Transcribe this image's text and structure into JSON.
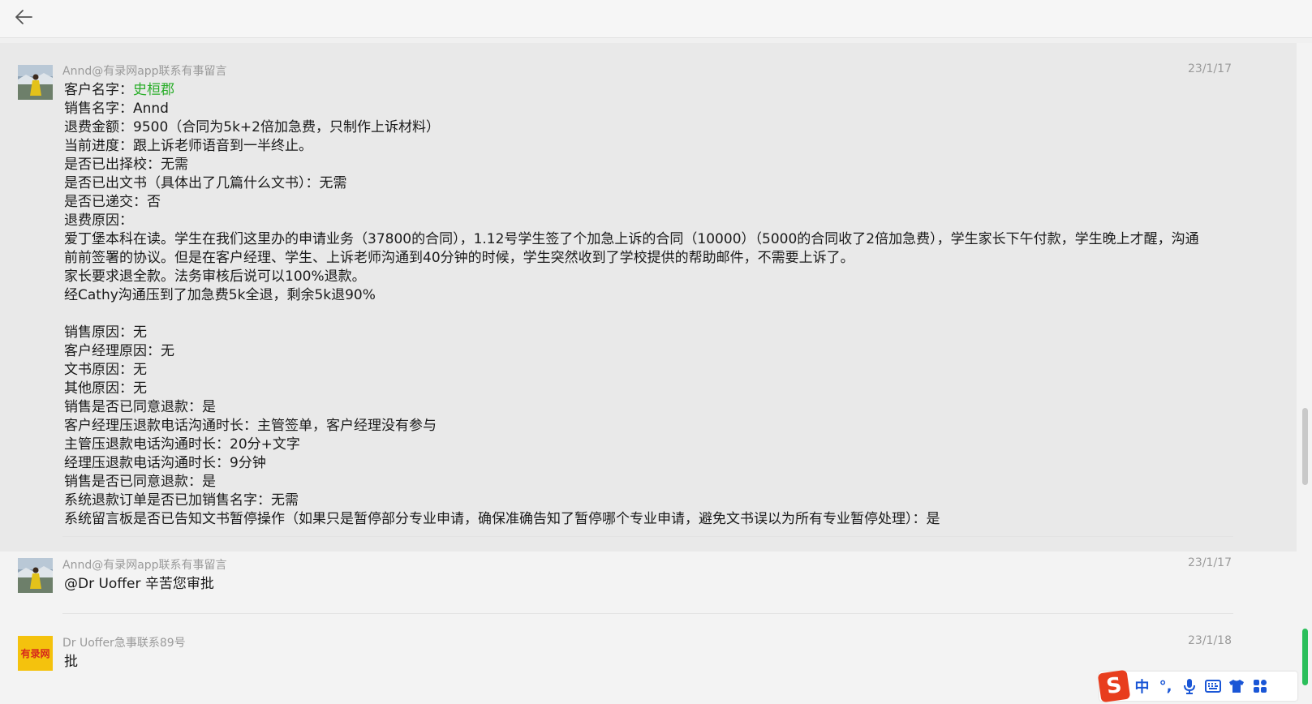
{
  "header": {
    "back_icon": "arrow-left-icon"
  },
  "messages": [
    {
      "sender": "Annd@有录网app联系有事留言",
      "timestamp": "23/1/17",
      "avatar": "user-photo-avatar",
      "lines": {
        "customer_label": "客户名字：",
        "customer_name": "史桓郡",
        "l2": "销售名字：Annd",
        "l3": "退费金额：9500（合同为5k+2倍加急费，只制作上诉材料）",
        "l4": "当前进度：跟上诉老师语音到一半终止。",
        "l5": "是否已出择校：无需",
        "l6": "是否已出文书（具体出了几篇什么文书）：无需",
        "l7": "是否已递交：否",
        "l8": "退费原因：",
        "l9": "爱丁堡本科在读。学生在我们这里办的申请业务（37800的合同），1.12号学生签了个加急上诉的合同（10000）（5000的合同收了2倍加急费），学生家长下午付款，学生晚上才醒，沟通前前签署的协议。但是在客户经理、学生、上诉老师沟通到40分钟的时候，学生突然收到了学校提供的帮助邮件，不需要上诉了。",
        "l10": "家长要求退全款。法务审核后说可以100%退款。",
        "l11": "经Cathy沟通压到了加急费5k全退，剩余5k退90%",
        "l12": "销售原因：无",
        "l13": "客户经理原因：无",
        "l14": "文书原因：无",
        "l15": "其他原因：无",
        "l16": "销售是否已同意退款：是",
        "l17": "客户经理压退款电话沟通时长：主管签单，客户经理没有参与",
        "l18": "主管压退款电话沟通时长：20分+文字",
        "l19": "经理压退款电话沟通时长：9分钟",
        "l20": "销售是否已同意退款：是",
        "l21": "系统退款订单是否已加销售名字：无需",
        "l22": "系统留言板是否已告知文书暂停操作（如果只是暂停部分专业申请，确保准确告知了暂停哪个专业申请，避免文书误以为所有专业暂停处理）：是"
      }
    },
    {
      "sender": "Annd@有录网app联系有事留言",
      "timestamp": "23/1/17",
      "avatar": "user-photo-avatar",
      "text": "@Dr Uoffer 辛苦您审批"
    },
    {
      "sender": "Dr Uoffer急事联系89号",
      "timestamp": "23/1/18",
      "avatar": "company-logo-avatar",
      "avatar_text": "有录网",
      "text": "批"
    }
  ],
  "ime": {
    "logo": "S",
    "lang": "中",
    "punct": "°,",
    "icons": [
      "microphone-icon",
      "keyboard-icon",
      "shirt-icon",
      "grid-icon"
    ]
  },
  "colors": {
    "accent_green": "#2aae2a",
    "ime_red": "#e83d1d",
    "ime_blue": "#1a56d6"
  }
}
